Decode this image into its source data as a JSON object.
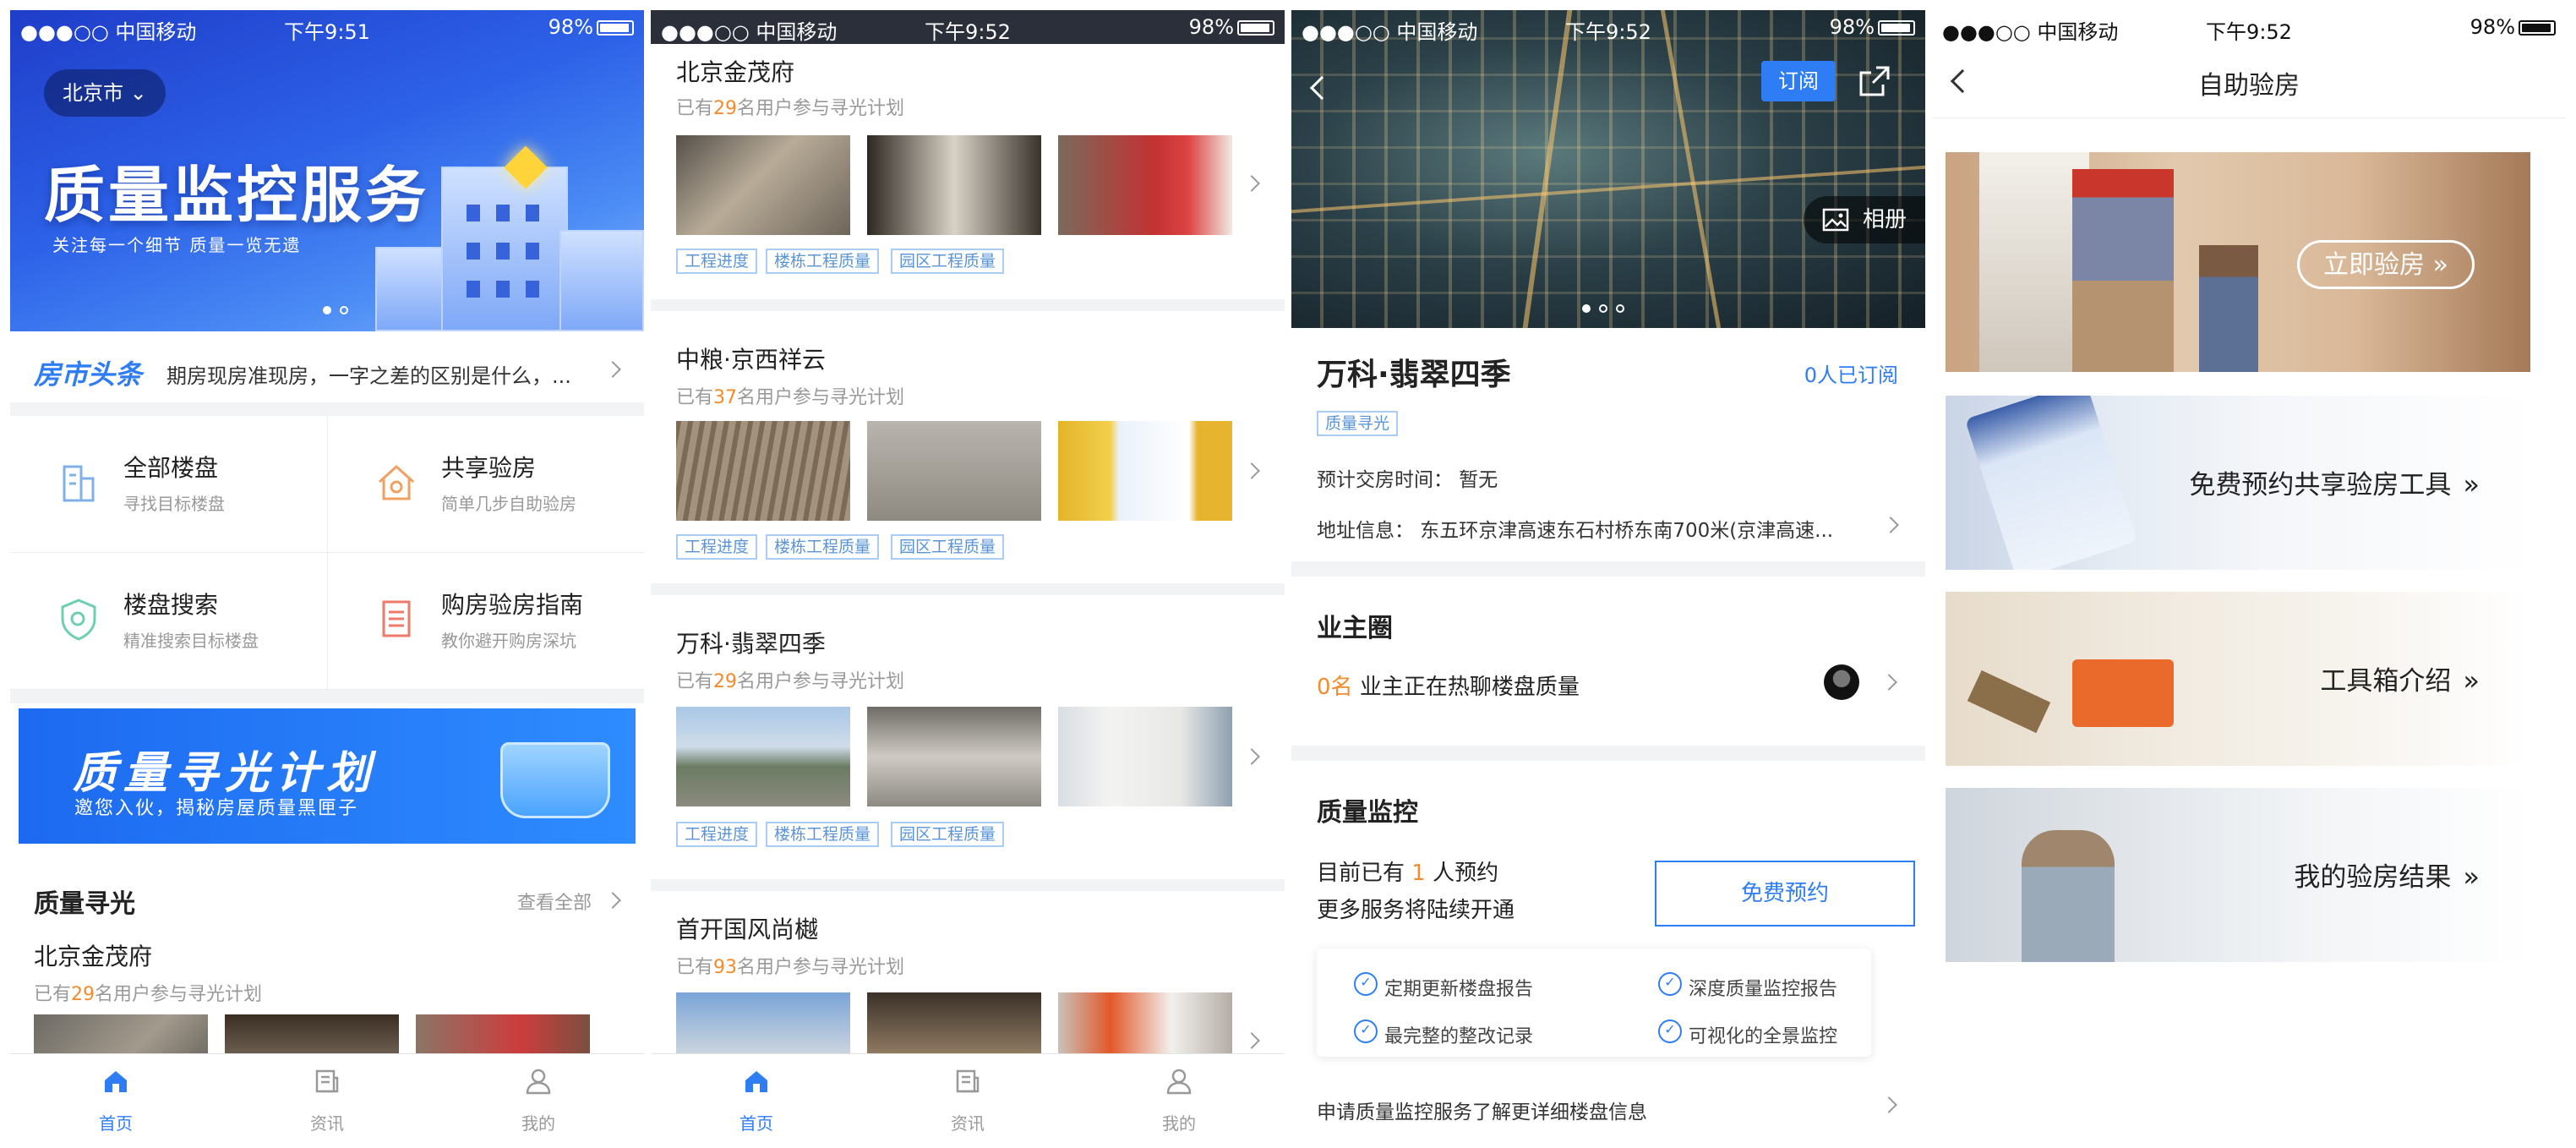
{
  "status_bars": [
    {
      "carrier": "●●●○○ 中国移动",
      "time": "下午9:51",
      "battery": "98%"
    },
    {
      "carrier": "●●●○○ 中国移动",
      "time": "下午9:52",
      "battery": "98%"
    },
    {
      "carrier": "●●●○○ 中国移动",
      "time": "下午9:52",
      "battery": "98%"
    },
    {
      "carrier": "●●●○○ 中国移动",
      "time": "下午9:52",
      "battery": "98%"
    }
  ],
  "home": {
    "city": "北京市",
    "hero_title": "质量监控服务",
    "hero_sub": "关注每一个细节 质量一览无遗",
    "news_brand": "房市头条",
    "news_text": "期房现房准现房，一字之差的区别是什么，...",
    "grid": [
      {
        "name": "全部楼盘",
        "desc": "寻找目标楼盘"
      },
      {
        "name": "共享验房",
        "desc": "简单几步自助验房"
      },
      {
        "name": "楼盘搜索",
        "desc": "精准搜索目标楼盘"
      },
      {
        "name": "购房验房指南",
        "desc": "教你避开购房深坑"
      }
    ],
    "banner_title": "质量寻光计划",
    "banner_sub": "邀您入伙，揭秘房屋质量黑匣子",
    "section_title": "质量寻光",
    "section_more": "查看全部",
    "project_name": "北京金茂府",
    "project_prefix": "已有",
    "project_count": "29",
    "project_suffix": "名用户参与寻光计划"
  },
  "tabs": [
    {
      "label": "首页",
      "icon": "home-icon"
    },
    {
      "label": "资讯",
      "icon": "news-icon"
    },
    {
      "label": "我的",
      "icon": "user-icon"
    }
  ],
  "list": {
    "prefix": "已有",
    "suffix": "名用户参与寻光计划",
    "tags": [
      "工程进度",
      "楼栋工程质量",
      "园区工程质量"
    ],
    "projects": [
      {
        "name": "北京金茂府",
        "count": "29"
      },
      {
        "name": "中粮·京西祥云",
        "count": "37"
      },
      {
        "name": "万科·翡翠四季",
        "count": "29"
      },
      {
        "name": "首开国风尚樾",
        "count": "93"
      }
    ]
  },
  "detail": {
    "subscribe_label": "订阅",
    "album_label": "相册",
    "name": "万科·翡翠四季",
    "subscribers": "0人已订阅",
    "tag": "质量寻光",
    "delivery": "预计交房时间：  暂无",
    "address": "地址信息：  东五环京津高速东石村桥东南700米(京津高速...",
    "owner_title": "业主圈",
    "owner_count": "0名",
    "owner_text": "业主正在热聊楼盘质量",
    "qc_title": "质量监控",
    "qc_prefix": "目前已有",
    "qc_count": "1",
    "qc_suffix": "人预约",
    "qc_more": "更多服务将陆续开通",
    "qc_button": "免费预约",
    "features": [
      "定期更新楼盘报告",
      "深度质量监控报告",
      "最完整的整改记录",
      "可视化的全景监控"
    ],
    "footer_link": "申请质量监控服务了解更详细楼盘信息"
  },
  "inspect": {
    "title": "自助验房",
    "cta": "立即验房",
    "items": [
      "免费预约共享验房工具",
      "工具箱介绍",
      "我的验房结果"
    ]
  }
}
